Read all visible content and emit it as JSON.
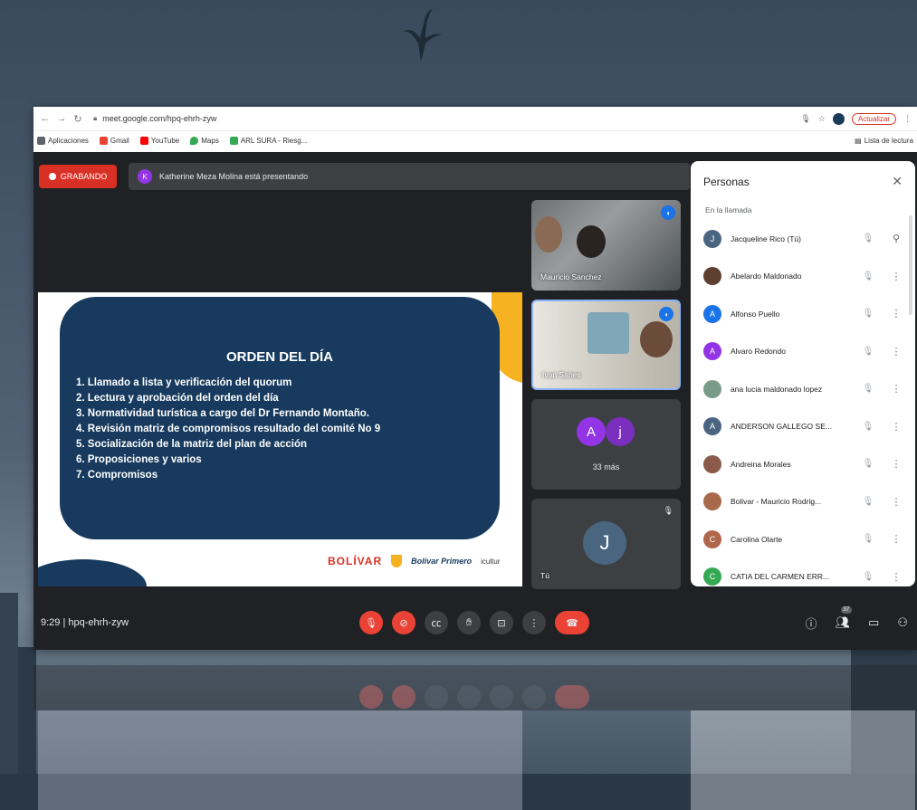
{
  "browser": {
    "url": "meet.google.com/hpq-ehrh-zyw",
    "update_label": "Actualizar",
    "bookmarks": [
      {
        "label": "Aplicaciones",
        "icon": "apps-icon",
        "color": "#5f6368"
      },
      {
        "label": "Gmail",
        "icon": "gmail-icon",
        "color": "#ea4335"
      },
      {
        "label": "YouTube",
        "icon": "youtube-icon",
        "color": "#ff0000"
      },
      {
        "label": "Maps",
        "icon": "maps-icon",
        "color": "#34a853"
      },
      {
        "label": "ARL SURA - Riesg...",
        "icon": "sura-icon",
        "color": "#34a853"
      }
    ],
    "reading_list": "Lista de lectura"
  },
  "meet": {
    "recording_label": "GRABANDO",
    "presenter_initial": "K",
    "presenting_text": "Katherine Meza Molina está presentando",
    "slide": {
      "title": "ORDEN DEL DÍA",
      "items": [
        "1. Llamado a lista y verificación del quorum",
        "2. Lectura y aprobación del orden del día",
        "3. Normatividad turística a cargo del  Dr Fernando Montaño.",
        "4. Revisión matriz de compromisos resultado del comité No 9",
        "5. Socialización de la matriz del plan de acción",
        "6. Proposiciones y varios",
        "7. Compromisos"
      ],
      "logos": {
        "bolivar": "BOLÍVAR",
        "primero": "Bolívar Primero",
        "icul": "icultur"
      }
    },
    "tiles": {
      "tile1_name": "Mauricio Sanchez",
      "tile2_name": "Ivan Sanes",
      "tile3_avatars": [
        {
          "initial": "A",
          "color": "#9334e6"
        },
        {
          "initial": "j",
          "color": "#7b2fbe"
        }
      ],
      "tile3_more": "33 más",
      "tile4_initial": "J",
      "tile4_name": "Tú"
    },
    "bottom": {
      "time_code": "9:29  |  hpq-ehrh-zyw",
      "people_count": "37"
    },
    "panel": {
      "title": "Personas",
      "section": "En la llamada",
      "people": [
        {
          "name": "Jacqueline Rico (Tú)",
          "initial": "J",
          "color": "#4a6580",
          "action": "pin"
        },
        {
          "name": "Abelardo Maldonado",
          "initial": "",
          "color": "#5d4030",
          "action": "menu"
        },
        {
          "name": "Alfonso Puello",
          "initial": "A",
          "color": "#1a73e8",
          "action": "menu"
        },
        {
          "name": "Alvaro Redondo",
          "initial": "A",
          "color": "#9334e6",
          "action": "menu"
        },
        {
          "name": "ana lucia maldonado lopez",
          "initial": "",
          "color": "#7a9a8a",
          "action": "menu"
        },
        {
          "name": "ANDERSON GALLEGO SE...",
          "initial": "A",
          "color": "#4a6580",
          "action": "menu"
        },
        {
          "name": "Andreina Morales",
          "initial": "",
          "color": "#8a5a4a",
          "action": "menu"
        },
        {
          "name": "Bolivar - Mauricio Rodrig...",
          "initial": "",
          "color": "#a86a4a",
          "action": "menu"
        },
        {
          "name": "Carolina Olarte",
          "initial": "C",
          "color": "#b0664a",
          "action": "menu"
        },
        {
          "name": "CATIA DEL CARMEN ERR...",
          "initial": "C",
          "color": "#34a853",
          "action": "menu"
        }
      ]
    }
  }
}
